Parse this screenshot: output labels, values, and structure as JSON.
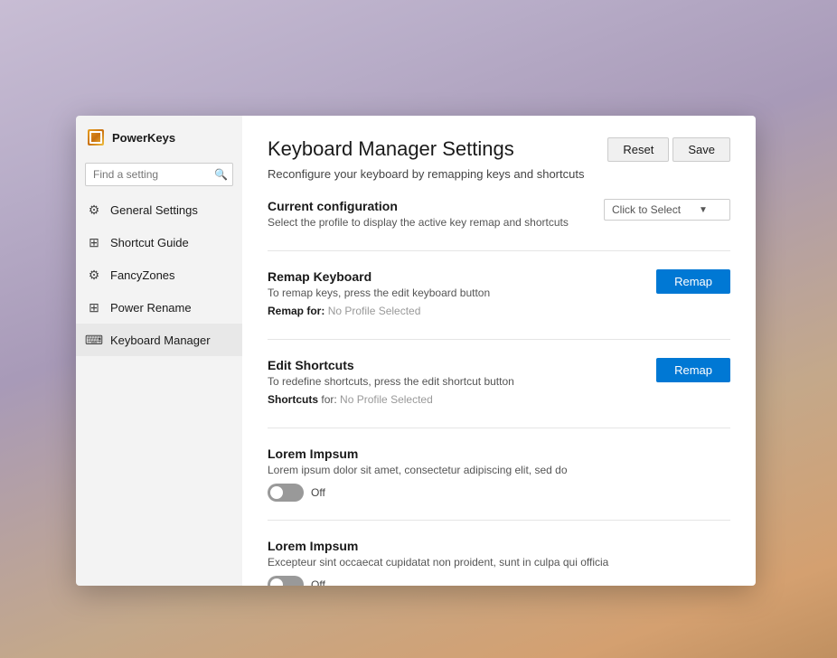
{
  "app": {
    "name": "PowerKeys"
  },
  "sidebar": {
    "search_placeholder": "Find a setting",
    "items": [
      {
        "id": "general",
        "label": "General Settings",
        "icon": "gear"
      },
      {
        "id": "shortcut-guide",
        "label": "Shortcut Guide",
        "icon": "grid"
      },
      {
        "id": "fancyzones",
        "label": "FancyZones",
        "icon": "gear"
      },
      {
        "id": "power-rename",
        "label": "Power Rename",
        "icon": "grid"
      },
      {
        "id": "keyboard-manager",
        "label": "Keyboard Manager",
        "icon": "keyboard",
        "active": true
      }
    ]
  },
  "main": {
    "title": "Keyboard Manager Settings",
    "subtitle": "Reconfigure your keyboard by remapping keys and shortcuts",
    "reset_label": "Reset",
    "save_label": "Save",
    "sections": [
      {
        "id": "current-config",
        "title": "Current configuration",
        "desc": "Select the profile to display the active key remap and shortcuts",
        "dropdown_label": "Click to Select",
        "has_remap_button": false,
        "has_toggle": false
      },
      {
        "id": "remap-keyboard",
        "title": "Remap Keyboard",
        "desc": "To remap keys, press the edit keyboard button",
        "remap_for_label": "Remap for:",
        "no_profile_label": "No Profile Selected",
        "remap_button_label": "Remap",
        "has_toggle": false
      },
      {
        "id": "edit-shortcuts",
        "title": "Edit Shortcuts",
        "desc": "To redefine shortcuts, press the edit shortcut button",
        "shortcuts_for_label": "Shortcuts",
        "for_word": "for:",
        "no_profile_label": "No Profile Selected",
        "remap_button_label": "Remap",
        "has_toggle": false
      },
      {
        "id": "lorem1",
        "title": "Lorem Impsum",
        "desc": "Lorem ipsum dolor sit amet, consectetur adipiscing elit, sed do",
        "toggle_state": "off",
        "toggle_label": "Off"
      },
      {
        "id": "lorem2",
        "title": "Lorem Impsum",
        "desc": "Excepteur sint occaecat cupidatat non proident, sunt in culpa qui officia",
        "toggle_state": "off",
        "toggle_label": "Off"
      }
    ]
  }
}
